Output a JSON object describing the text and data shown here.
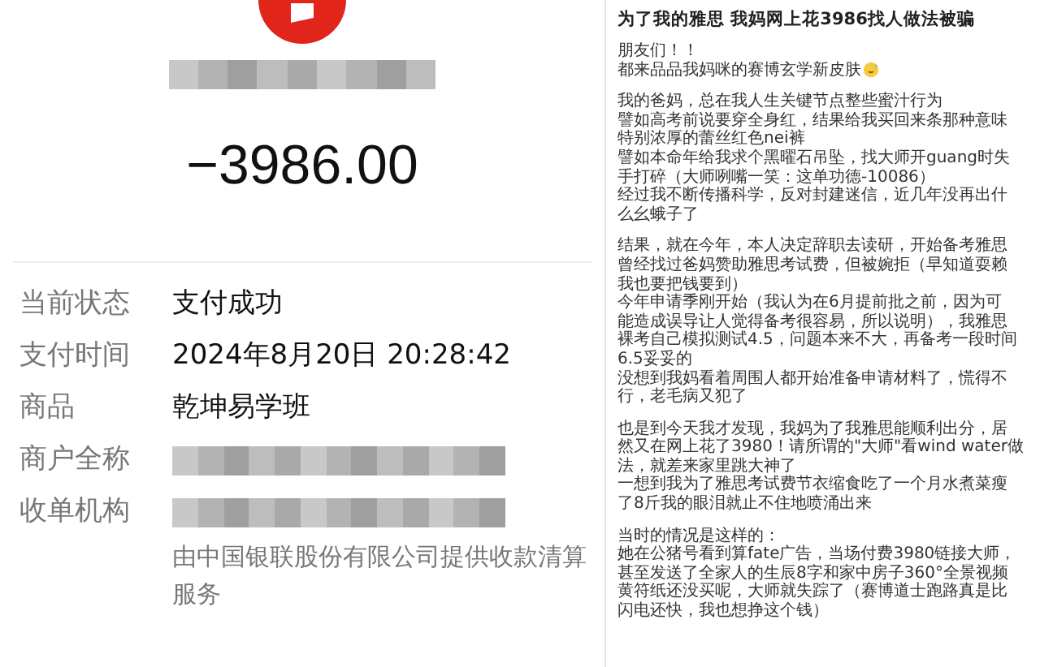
{
  "payment": {
    "payee_redacted": true,
    "amount": "−3986.00",
    "details": [
      {
        "label": "当前状态",
        "value": "支付成功",
        "redacted": false
      },
      {
        "label": "支付时间",
        "value": "2024年8月20日 20:28:42",
        "redacted": false
      },
      {
        "label": "商品",
        "value": "乾坤易学班",
        "redacted": false
      },
      {
        "label": "商户全称",
        "redacted": true
      },
      {
        "label": "收单机构",
        "redacted": true
      }
    ],
    "note": "由中国银联股份有限公司提供收款清算服务"
  },
  "post": {
    "title": "为了我的雅思 我妈网上花3986找人做法被骗",
    "paragraphs": [
      [
        {
          "text": "朋友们！！"
        },
        {
          "text": "都来品品我妈咪的赛博玄学新皮肤",
          "emoji": true
        }
      ],
      [
        {
          "text": "我的爸妈，总在我人生关键节点整些蜜汁行为"
        },
        {
          "text": "譬如高考前说要穿全身红，结果给我买回来条那种意味"
        },
        {
          "text": "特别浓厚的蕾丝红色nei裤"
        },
        {
          "text": "譬如本命年给我求个黑曜石吊坠，找大师开guang时失"
        },
        {
          "text": "手打碎（大师咧嘴一笑：这单功德-10086）"
        },
        {
          "text": "经过我不断传播科学，反对封建迷信，近几年没再出什"
        },
        {
          "text": "么幺蛾子了"
        }
      ],
      [
        {
          "text": "结果，就在今年，本人决定辞职去读研，开始备考雅思"
        },
        {
          "text": "曾经找过爸妈赞助雅思考试费，但被婉拒（早知道耍赖"
        },
        {
          "text": "我也要把钱要到）"
        },
        {
          "text": "今年申请季刚开始（我认为在6月提前批之前，因为可"
        },
        {
          "text": "能造成误导让人觉得备考很容易，所以说明），我雅思"
        },
        {
          "text": "裸考自己模拟测试4.5，问题本来不大，再备考一段时间"
        },
        {
          "text": "6.5妥妥的"
        },
        {
          "text": "没想到我妈看着周围人都开始准备申请材料了，慌得不"
        },
        {
          "text": "行，老毛病又犯了"
        }
      ],
      [
        {
          "text": "也是到今天我才发现，我妈为了我雅思能顺利出分，居"
        },
        {
          "text": "然又在网上花了3980！请所谓的\"大师\"看wind water做"
        },
        {
          "text": "法，就差来家里跳大神了"
        },
        {
          "text": "一想到我为了雅思考试费节衣缩食吃了一个月水煮菜瘦"
        },
        {
          "text": "了8斤我的眼泪就止不住地喷涌出来"
        }
      ],
      [
        {
          "text": "当时的情况是这样的："
        },
        {
          "text": "她在公猪号看到算fate广告，当场付费3980链接大师，"
        },
        {
          "text": "甚至发送了全家人的生辰8字和家中房子360°全景视频"
        },
        {
          "text": "黄符纸还没买呢，大师就失踪了（赛博道士跑路真是比"
        },
        {
          "text": "闪电还快，我也想挣这个钱）"
        }
      ]
    ]
  }
}
